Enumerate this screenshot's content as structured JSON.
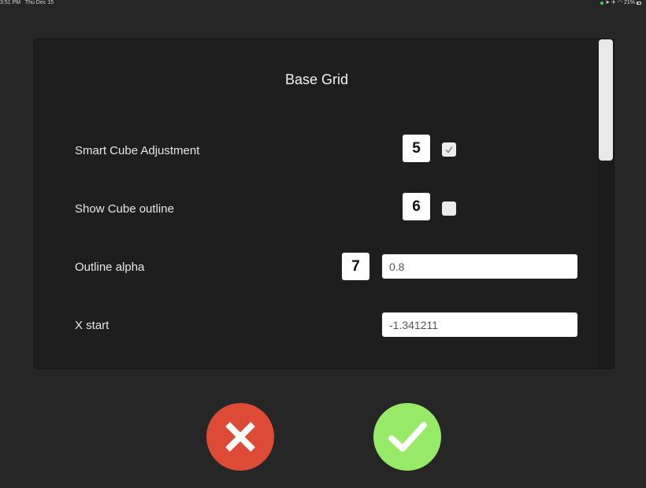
{
  "status_bar": {
    "time": "3:51 PM",
    "date": "Thu Dec 15",
    "battery": "21%",
    "battery_level": 0.21
  },
  "dialog": {
    "title": "Base Grid",
    "rows": [
      {
        "label": "Smart Cube Adjustment",
        "badge": "5",
        "checked": true
      },
      {
        "label": "Show Cube outline",
        "badge": "6",
        "checked": false
      },
      {
        "label": "Outline alpha",
        "badge": "7",
        "value": "0.8"
      },
      {
        "label": "X start",
        "value": "-1.341211"
      }
    ]
  },
  "actions": {
    "cancel": {
      "icon": "x-icon",
      "color": "#dd4b37"
    },
    "confirm": {
      "icon": "checkmark-icon",
      "color": "#96ea68"
    }
  }
}
